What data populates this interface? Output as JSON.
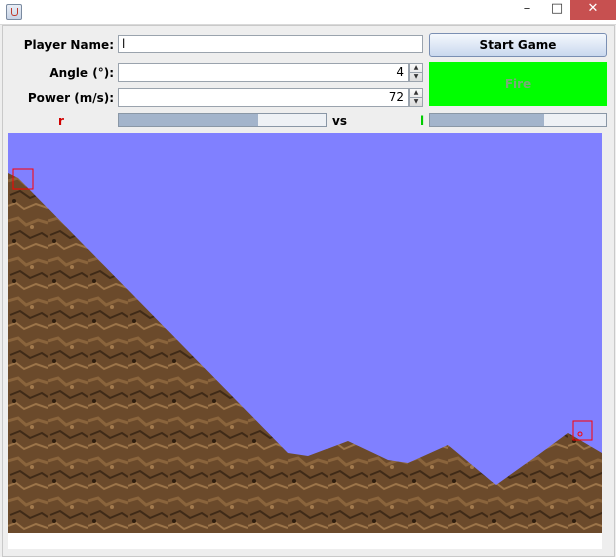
{
  "window": {
    "minimize_glyph": "–",
    "maximize_glyph": "□",
    "close_glyph": "✕"
  },
  "form": {
    "player_name_label": "Player Name:",
    "player_name_value": "l",
    "angle_label": "Angle (°):",
    "angle_value": "4",
    "power_label": "Power (m/s):",
    "power_value": "72",
    "spin_up": "▲",
    "spin_down": "▼"
  },
  "buttons": {
    "start_label": "Start Game",
    "fire_label": "Fire",
    "fire_color": "#00ff00"
  },
  "players": {
    "left_name": "r",
    "left_color": "#d00000",
    "left_health": 0.67,
    "vs_label": "vs",
    "right_name": "l",
    "right_color": "#00cc00",
    "right_health": 0.65
  },
  "game": {
    "sky_color": "#8080ff",
    "terrain_color": "#6b4a2b",
    "marker_color": "#ff0000"
  }
}
